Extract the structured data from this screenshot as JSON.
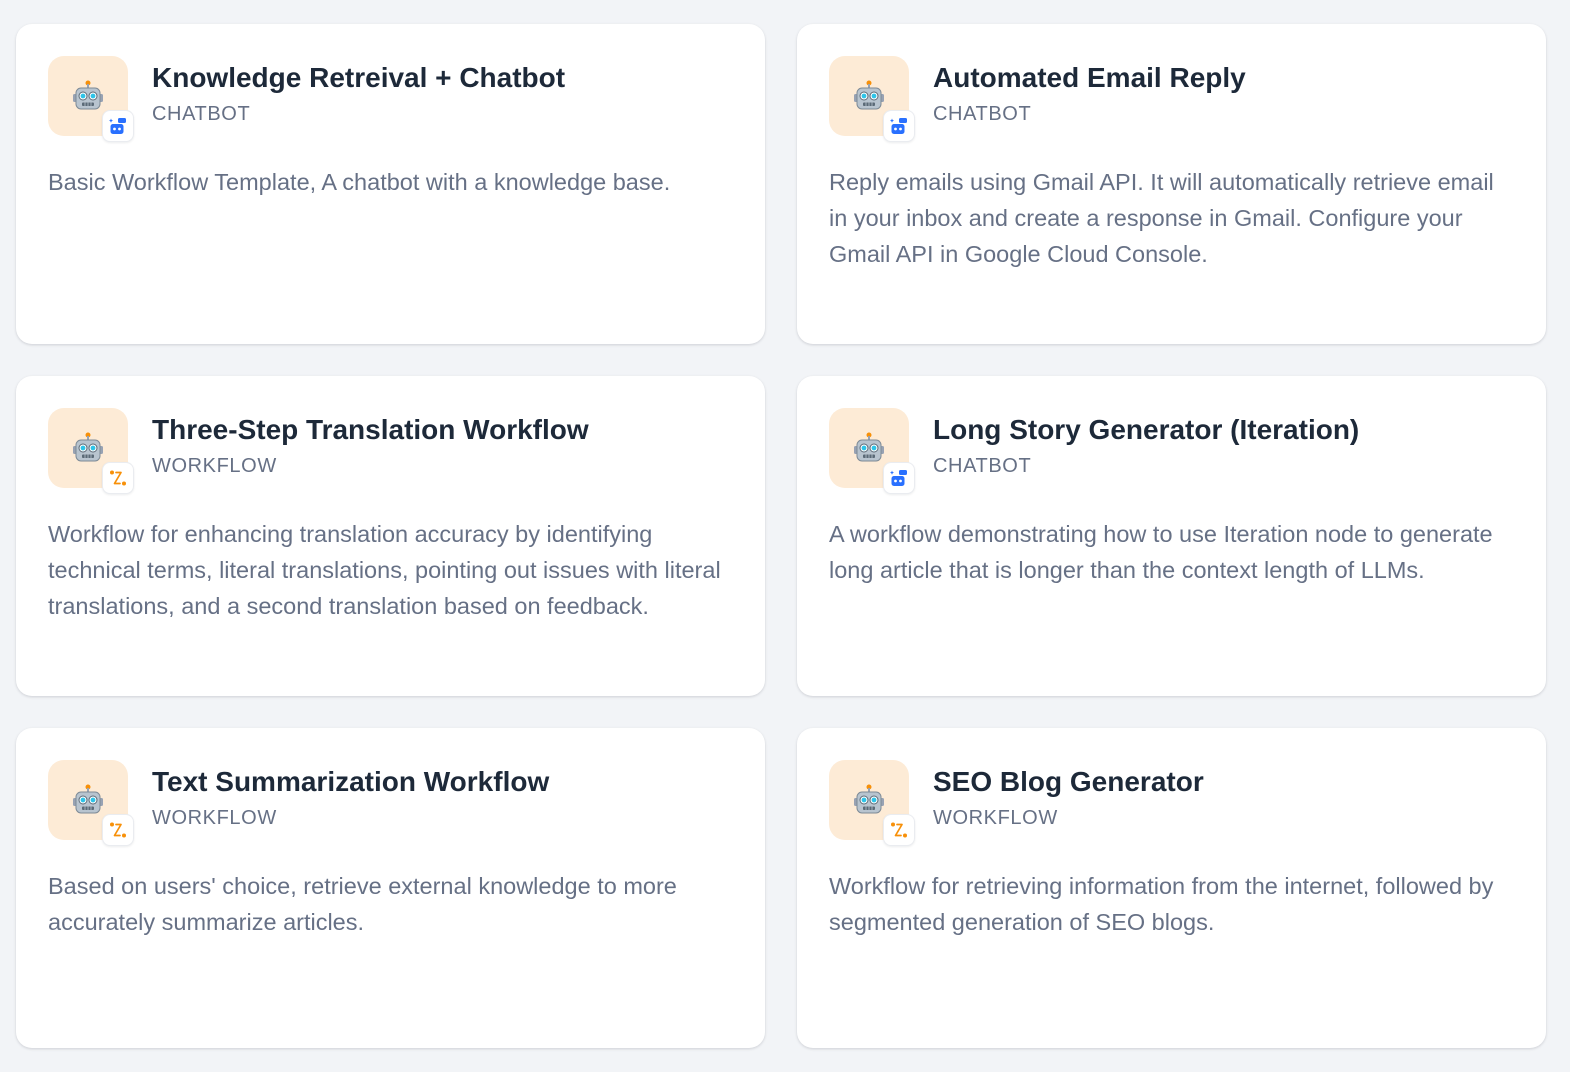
{
  "cards": [
    {
      "title": "Knowledge Retreival + Chatbot",
      "type": "CHATBOT",
      "badge_icon": "chatbot-icon",
      "description": "Basic Workflow Template, A chatbot with a knowledge base."
    },
    {
      "title": "Automated Email Reply",
      "type": "CHATBOT",
      "badge_icon": "chatbot-icon",
      "description": "Reply emails using Gmail API. It will automatically retrieve email in your inbox and create a response in Gmail. Configure your Gmail API in Google Cloud Console."
    },
    {
      "title": "Three-Step Translation Workflow",
      "type": "WORKFLOW",
      "badge_icon": "workflow-icon",
      "description": "Workflow for enhancing translation accuracy by identifying technical terms, literal translations, pointing out issues with literal translations, and a second translation based on feedback."
    },
    {
      "title": "Long Story Generator (Iteration)",
      "type": "CHATBOT",
      "badge_icon": "chatbot-icon",
      "description": "A workflow demonstrating how to use Iteration node to generate long article that is longer than the context length of LLMs."
    },
    {
      "title": "Text Summarization Workflow",
      "type": "WORKFLOW",
      "badge_icon": "workflow-icon",
      "description": "Based on users' choice, retrieve external knowledge to more accurately summarize articles."
    },
    {
      "title": "SEO Blog Generator",
      "type": "WORKFLOW",
      "badge_icon": "workflow-icon",
      "description": "Workflow for retrieving information from the internet, followed by segmented generation of SEO blogs."
    }
  ],
  "colors": {
    "page_background": "#f2f4f7",
    "card_background": "#ffffff",
    "icon_background": "#fdebd6",
    "title": "#1d2939",
    "muted_text": "#667085",
    "chatbot_badge": "#2970ff",
    "workflow_badge": "#f79009"
  }
}
